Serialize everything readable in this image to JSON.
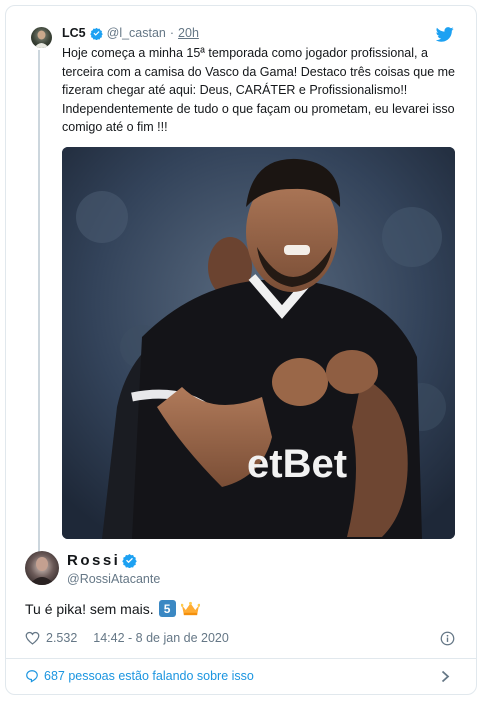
{
  "tweet": {
    "author_name": "LC5",
    "handle": "@l_castan",
    "separator": "·",
    "time": "20h",
    "text": "Hoje começa a minha 15ª temporada como jogador profissional, a terceira com a camisa do Vasco da Gama! Destaco três coisas que me fizeram chegar até aqui: Deus, CARÁTER e Profissionalismo!! Independentemente de tudo o que façam ou prometam, eu levarei isso comigo até o fim !!!",
    "photo_shirt_text": "etBet"
  },
  "reply": {
    "author_name": "Rossi",
    "handle": "@RossiAtacante",
    "text": "Tu é pika! sem mais.",
    "emoji_number": "5",
    "likes": "2.532",
    "timestamp": "14:42 - 8 de jan de 2020"
  },
  "footer": {
    "label": "687 pessoas estão falando sobre isso"
  },
  "colors": {
    "twitter_blue": "#1da1f2",
    "link_blue": "#1b95e0",
    "muted": "#657786",
    "border": "#e1e8ed"
  },
  "icons": [
    "verified-badge-icon",
    "twitter-bird-icon",
    "heart-icon",
    "info-icon",
    "speech-bubble-icon",
    "chevron-right-icon",
    "crown-emoji-icon"
  ]
}
